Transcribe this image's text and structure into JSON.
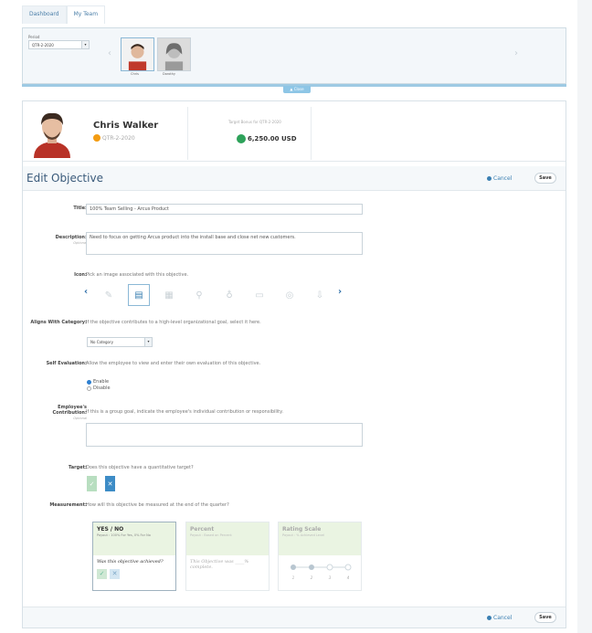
{
  "tabs": [
    "Dashboard",
    "My Team"
  ],
  "period": {
    "label": "Period",
    "value": "QTR-2-2020"
  },
  "people": [
    {
      "name": "Chris"
    },
    {
      "name": "Dorothy"
    }
  ],
  "close_label": "▲ Close",
  "profile": {
    "name": "Chris Walker",
    "period": "QTR-2-2020",
    "target_label": "Target Bonus for QTR-2-2020",
    "target_value": "6,250.00 USD"
  },
  "edit": {
    "title": "Edit Objective",
    "cancel": "Cancel",
    "save": "Save"
  },
  "fields": {
    "title_label": "Title:",
    "title_value": "100% Team Selling - Arcus Product",
    "desc_label": "Description:",
    "desc_opt": "Optional",
    "desc_value": "Need to focus on getting Arcus product into the install base and close net new customers.",
    "icon_label": "Icon:",
    "icon_hint": "Pick an image associated with this objective.",
    "aligns_label": "Aligns With Category:",
    "aligns_hint": "If the objective contributes to a high-level organizational goal, select it here.",
    "category_value": "No Category",
    "self_label": "Self Evaluation:",
    "self_hint": "Allow the employee to view and enter their own evaluation of this objective.",
    "enable": "Enable",
    "disable": "Disable",
    "contrib_label": "Employee's Contribution:",
    "contrib_opt": "Optional",
    "contrib_hint": "If this is a group goal, indicate the employee's individual contribution or responsibility.",
    "target_label": "Target:",
    "target_hint": "Does this objective have a quantitative target?",
    "meas_label": "Measurement:",
    "meas_hint": "How will this objective be measured at the end of the quarter?"
  },
  "measurements": [
    {
      "title": "YES / NO",
      "sub": "Payout : 100% For Yes, 0% For No",
      "body": "Was this objective achieved?"
    },
    {
      "title": "Percent",
      "sub": "Payout : Based on Percent",
      "body": "This Objective was ____% complete."
    },
    {
      "title": "Rating Scale",
      "sub": "Payout : % Achieved Level",
      "scale": [
        "1",
        "2",
        "3",
        "4"
      ]
    }
  ],
  "colors": {
    "accent": "#3a7fb2",
    "green_header": "#eaf4e2",
    "bluebar": "#9ecae3"
  }
}
